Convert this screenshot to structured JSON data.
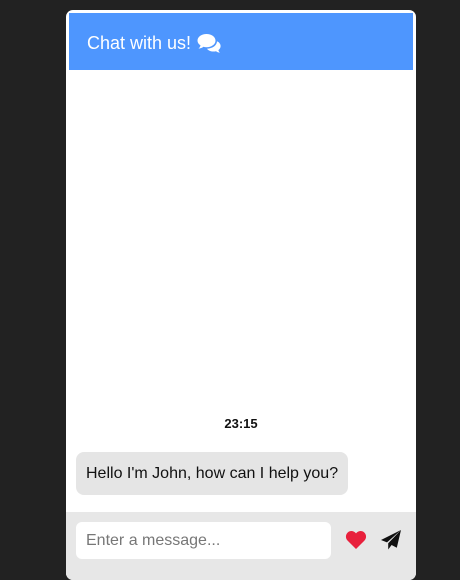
{
  "header": {
    "title": "Chat with us!",
    "icon": "comments-icon",
    "color": "#4e96fe"
  },
  "conversation": {
    "timestamp": "23:15",
    "messages": [
      {
        "sender": "agent",
        "text": "Hello I'm John, how can I help you?"
      }
    ]
  },
  "composer": {
    "placeholder": "Enter a message...",
    "value": "",
    "like_icon": "heart-icon",
    "like_color": "#e8203c",
    "send_icon": "paper-plane-icon"
  }
}
